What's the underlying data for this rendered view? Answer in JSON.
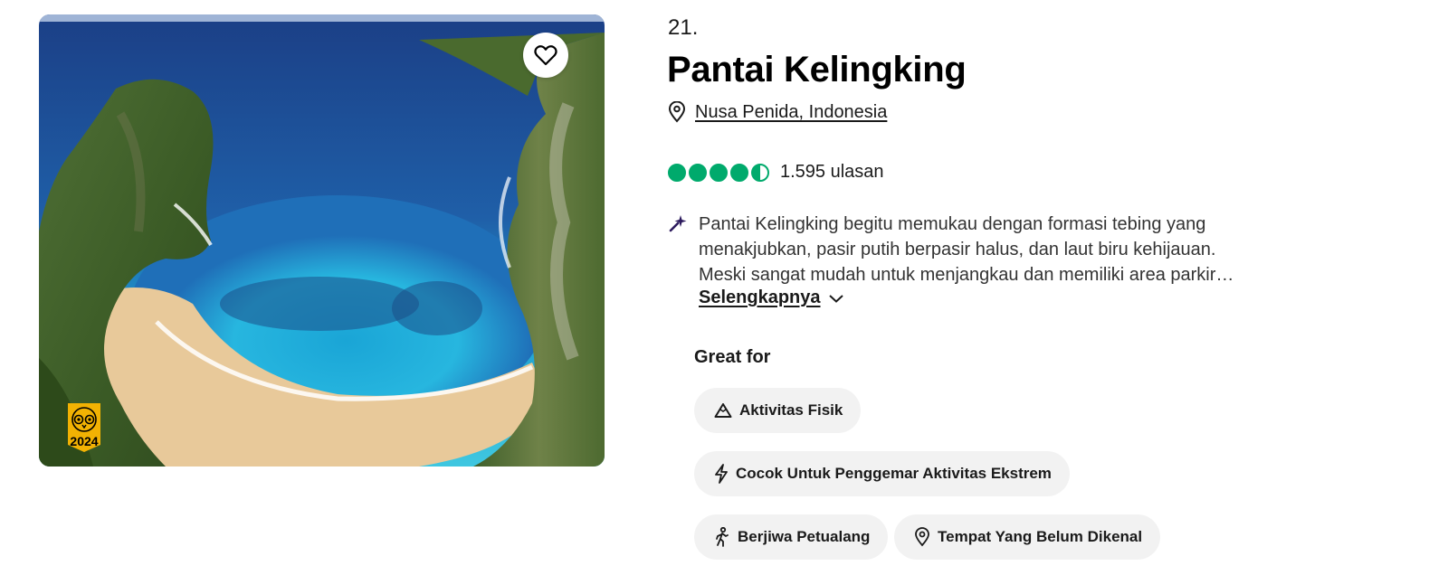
{
  "listing": {
    "rank": "21.",
    "title": "Pantai Kelingking",
    "location": "Nusa Penida, Indonesia",
    "rating": 4.5,
    "review_count": "1.595 ulasan",
    "award_year": "2024",
    "summary": "Pantai Kelingking begitu memukau dengan formasi tebing yang menakjubkan, pasir putih berpasir halus, dan laut biru kehijauan. Meski sangat mudah untuk menjangkau dan memiliki area parkir…",
    "read_more": "Selengkapnya"
  },
  "great_for": {
    "heading": "Great for",
    "tags": [
      {
        "label": "Aktivitas Fisik",
        "icon": "mountain-icon"
      },
      {
        "label": "Cocok Untuk Penggemar Aktivitas Ekstrem",
        "icon": "lightning-icon"
      },
      {
        "label": "Berjiwa Petualang",
        "icon": "hiker-icon"
      },
      {
        "label": "Tempat Yang Belum Dikenal",
        "icon": "map-pin-icon"
      }
    ]
  },
  "colors": {
    "rating_green": "#00aa6c",
    "chip_background": "#f2f2f2",
    "award_yellow": "#f2b203",
    "ai_sparkle": "#2d1b5e"
  }
}
